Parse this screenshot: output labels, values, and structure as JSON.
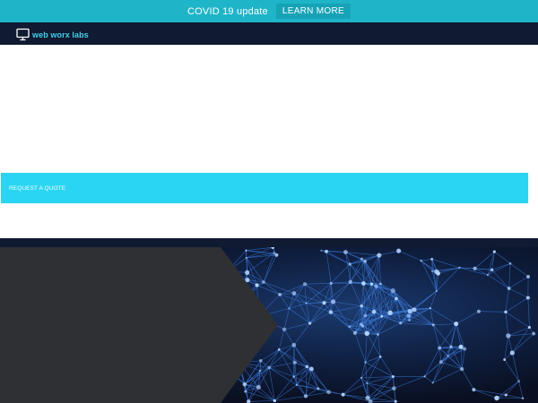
{
  "announcement": {
    "text": "COVID 19 update",
    "button_label": "LEARN MORE"
  },
  "brand": {
    "name": "web worx labs",
    "icon": "monitor-icon"
  },
  "hero": {
    "cta_label": "REQUEST A QUOTE"
  },
  "colors": {
    "announcement_bg": "#1fb5c9",
    "navbar_bg": "#101a30",
    "accent": "#29d5f2",
    "panel": "#2e3033",
    "network_line": "#3a78d8"
  }
}
